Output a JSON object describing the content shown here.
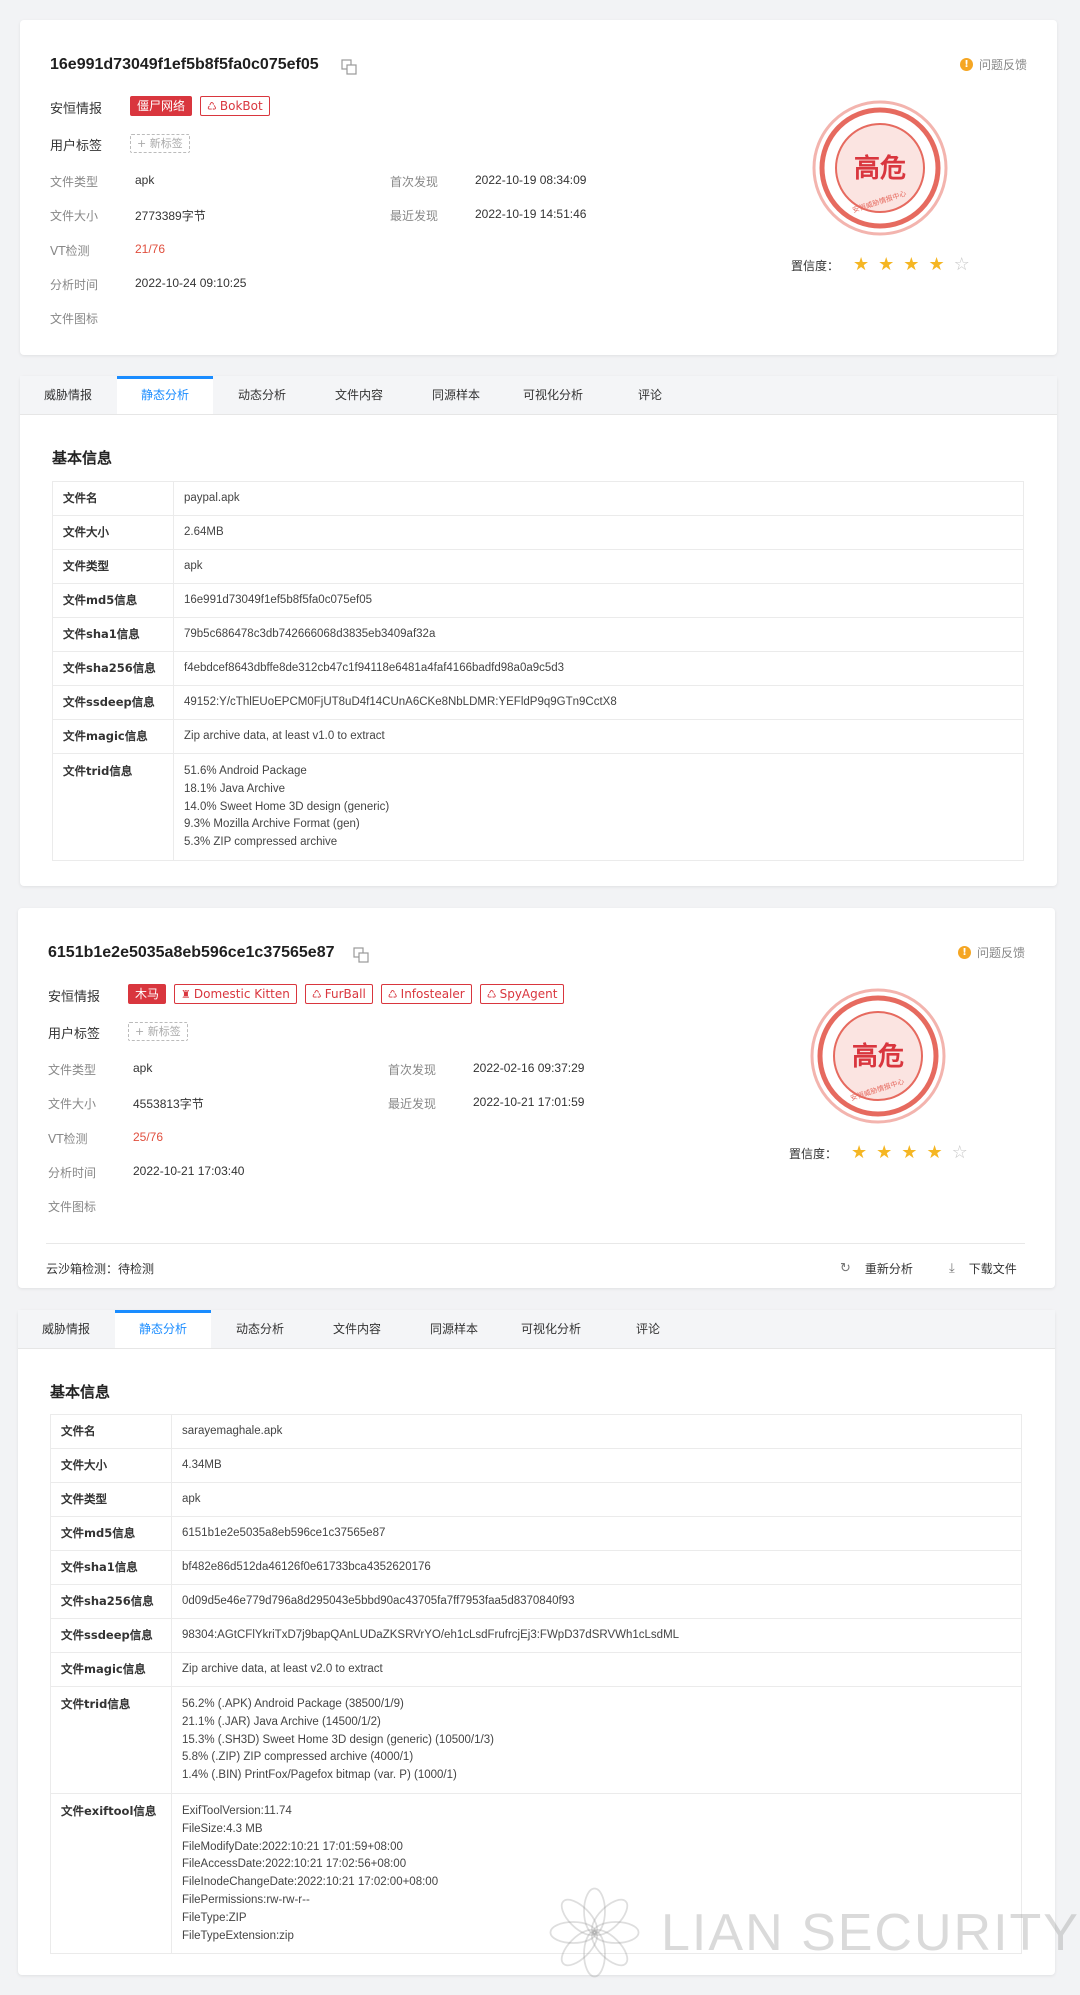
{
  "common": {
    "feedback": "问题反馈",
    "label_intel": "安恒情报",
    "label_usertags": "用户标签",
    "new_tag": "+ 新标签",
    "meta_labels": {
      "file_type": "文件类型",
      "file_size": "文件大小",
      "vt": "VT检测",
      "analysis_time": "分析时间",
      "file_icon": "文件图标",
      "first_seen": "首次发现",
      "last_seen": "最近发现"
    },
    "confidence_label": "置信度：",
    "seal_text": "高危",
    "seal_ring": "安恒威胁情报中心",
    "tabs": [
      "威胁情报",
      "静态分析",
      "动态分析",
      "文件内容",
      "同源样本",
      "可视化分析",
      "评论"
    ],
    "active_tab": 1,
    "basic_info": "基本信息",
    "colors": {
      "accent": "#1a8cff",
      "danger": "#d9363e",
      "star": "#f5b623"
    },
    "watermark": "LIAN SECURITY"
  },
  "sample1": {
    "hash": "16e991d73049f1ef5b8f5fa0c075ef05",
    "tags": [
      {
        "label": "僵尸网络",
        "solid": true,
        "icon": ""
      },
      {
        "label": "BokBot",
        "solid": false,
        "icon": "bug-icon"
      }
    ],
    "file_type": "apk",
    "file_size": "2773389字节",
    "vt": "21/76",
    "analysis_time": "2022-10-24 09:10:25",
    "first_seen": "2022-10-19 08:34:09",
    "last_seen": "2022-10-19 14:51:46",
    "confidence": 4,
    "info_rows": [
      {
        "k": "文件名",
        "v": [
          "paypal.apk"
        ]
      },
      {
        "k": "文件大小",
        "v": [
          "2.64MB"
        ]
      },
      {
        "k": "文件类型",
        "v": [
          "apk"
        ]
      },
      {
        "k": "文件md5信息",
        "v": [
          "16e991d73049f1ef5b8f5fa0c075ef05"
        ]
      },
      {
        "k": "文件sha1信息",
        "v": [
          "79b5c686478c3db742666068d3835eb3409af32a"
        ]
      },
      {
        "k": "文件sha256信息",
        "v": [
          "f4ebdcef8643dbffe8de312cb47c1f94118e6481a4faf4166badfd98a0a9c5d3"
        ]
      },
      {
        "k": "文件ssdeep信息",
        "v": [
          "49152:Y/cThlEUoEPCM0FjUT8uD4f14CUnA6CKe8NbLDMR:YEFldP9q9GTn9CctX8"
        ]
      },
      {
        "k": "文件magic信息",
        "v": [
          "Zip archive data, at least v1.0 to extract"
        ]
      },
      {
        "k": "文件trid信息",
        "v": [
          "51.6% Android Package",
          "18.1% Java Archive",
          "14.0% Sweet Home 3D design (generic)",
          "9.3% Mozilla Archive Format (gen)",
          "5.3% ZIP compressed archive"
        ]
      }
    ]
  },
  "sample2": {
    "hash": "6151b1e2e5035a8eb596ce1c37565e87",
    "tags": [
      {
        "label": "木马",
        "solid": true,
        "icon": ""
      },
      {
        "label": "Domestic Kitten",
        "solid": false,
        "icon": "mask-icon"
      },
      {
        "label": "FurBall",
        "solid": false,
        "icon": "bug-icon"
      },
      {
        "label": "Infostealer",
        "solid": false,
        "icon": "bug-icon"
      },
      {
        "label": "SpyAgent",
        "solid": false,
        "icon": "bug-icon"
      }
    ],
    "file_type": "apk",
    "file_size": "4553813字节",
    "vt": "25/76",
    "analysis_time": "2022-10-21 17:03:40",
    "first_seen": "2022-02-16 09:37:29",
    "last_seen": "2022-10-21 17:01:59",
    "confidence": 4,
    "sandbox": "云沙箱检测：待检测",
    "reanalyze": "重新分析",
    "download": "下载文件",
    "info_rows": [
      {
        "k": "文件名",
        "v": [
          "sarayemaghale.apk"
        ]
      },
      {
        "k": "文件大小",
        "v": [
          "4.34MB"
        ]
      },
      {
        "k": "文件类型",
        "v": [
          "apk"
        ]
      },
      {
        "k": "文件md5信息",
        "v": [
          "6151b1e2e5035a8eb596ce1c37565e87"
        ]
      },
      {
        "k": "文件sha1信息",
        "v": [
          "bf482e86d512da46126f0e61733bca4352620176"
        ]
      },
      {
        "k": "文件sha256信息",
        "v": [
          "0d09d5e46e779d796a8d295043e5bbd90ac43705fa7ff7953faa5d8370840f93"
        ]
      },
      {
        "k": "文件ssdeep信息",
        "v": [
          "98304:AGtCFlYkriTxD7j9bapQAnLUDaZKSRVrYO/eh1cLsdFrufrcjEj3:FWpD37dSRVWh1cLsdML"
        ]
      },
      {
        "k": "文件magic信息",
        "v": [
          "Zip archive data, at least v2.0 to extract"
        ]
      },
      {
        "k": "文件trid信息",
        "v": [
          "56.2% (.APK) Android Package (38500/1/9)",
          "21.1% (.JAR) Java Archive (14500/1/2)",
          "15.3% (.SH3D) Sweet Home 3D design (generic) (10500/1/3)",
          "5.8% (.ZIP) ZIP compressed archive (4000/1)",
          "1.4% (.BIN) PrintFox/Pagefox bitmap (var. P) (1000/1)"
        ]
      },
      {
        "k": "文件exiftool信息",
        "v": [
          "ExifToolVersion:11.74",
          "FileSize:4.3 MB",
          "FileModifyDate:2022:10:21 17:01:59+08:00",
          "FileAccessDate:2022:10:21 17:02:56+08:00",
          "FileInodeChangeDate:2022:10:21 17:02:00+08:00",
          "FilePermissions:rw-rw-r--",
          "FileType:ZIP",
          "FileTypeExtension:zip"
        ]
      }
    ]
  }
}
